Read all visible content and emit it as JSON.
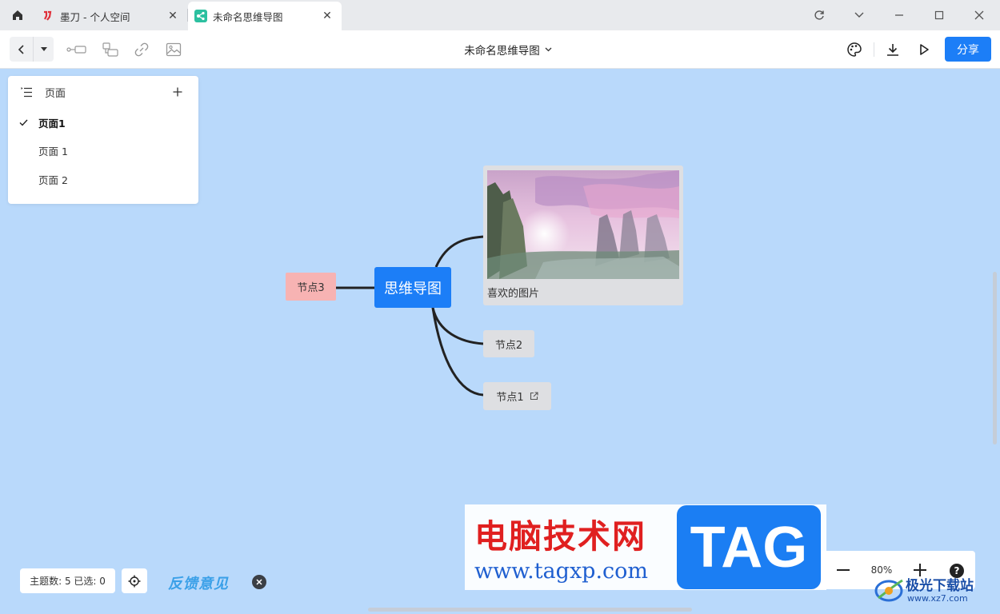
{
  "tabs": [
    {
      "title": "墨刀 - 个人空间",
      "active": false
    },
    {
      "title": "未命名思维导图",
      "active": true
    }
  ],
  "toolbar": {
    "doc_title": "未命名思维导图",
    "share_label": "分享"
  },
  "pages_panel": {
    "title": "页面",
    "items": [
      {
        "label": "页面1",
        "active": true
      },
      {
        "label": "页面 1",
        "active": false
      },
      {
        "label": "页面 2",
        "active": false
      }
    ]
  },
  "mindmap": {
    "root": "思维导图",
    "node3": "节点3",
    "node2": "节点2",
    "node1": "节点1",
    "image_caption": "喜欢的图片"
  },
  "status": {
    "text": "主题数: 5 已选: 0",
    "feedback": "反馈意见"
  },
  "zoom": {
    "value": "80%",
    "help": "?"
  },
  "watermarks": {
    "tag_cn": "电脑技术网",
    "tag_url": "www.tagxp.com",
    "tag_badge": "TAG",
    "xz_name": "极光下载站",
    "xz_url": "www.xz7.com"
  },
  "colors": {
    "accent": "#1c7ef7",
    "canvas": "#b9d9fb",
    "node_pink": "#f7b3b3",
    "node_gray": "#dedfe2"
  }
}
